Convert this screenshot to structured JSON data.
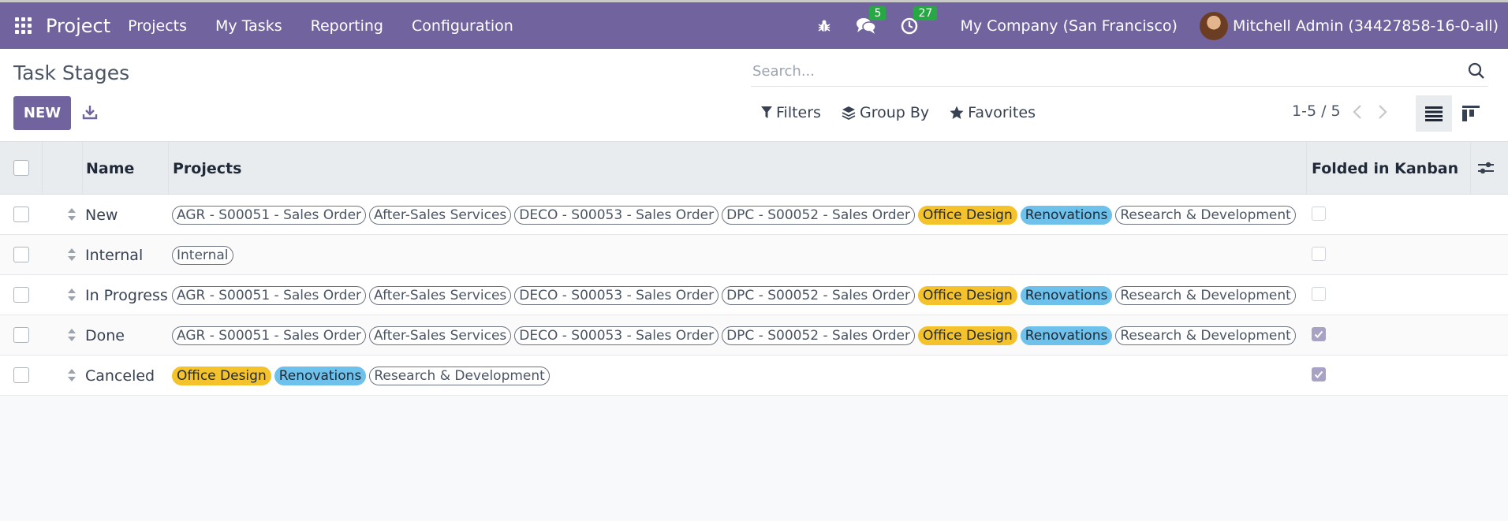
{
  "app": {
    "title": "Project",
    "menu": [
      "Projects",
      "My Tasks",
      "Reporting",
      "Configuration"
    ]
  },
  "systray": {
    "messages_count": "5",
    "activities_count": "27",
    "company": "My Company (San Francisco)",
    "user": "Mitchell Admin (34427858-16-0-all)"
  },
  "page": {
    "title": "Task Stages",
    "new_label": "NEW",
    "search_placeholder": "Search...",
    "filters_label": "Filters",
    "groupby_label": "Group By",
    "favorites_label": "Favorites",
    "pager": "1-5 / 5"
  },
  "colors": {
    "brand": "#71639e",
    "yellow_tag": "#f4c32c",
    "blue_tag": "#6ec1ea",
    "badge": "#28a745"
  },
  "table": {
    "headers": {
      "name": "Name",
      "projects": "Projects",
      "folded": "Folded in Kanban"
    },
    "rows": [
      {
        "name": "New",
        "projects": [
          {
            "label": "AGR - S00051 - Sales Order",
            "color": "none"
          },
          {
            "label": "After-Sales Services",
            "color": "none"
          },
          {
            "label": "DECO - S00053 - Sales Order",
            "color": "none"
          },
          {
            "label": "DPC - S00052 - Sales Order",
            "color": "none"
          },
          {
            "label": "Office Design",
            "color": "yellow"
          },
          {
            "label": "Renovations",
            "color": "blue"
          },
          {
            "label": "Research & Development",
            "color": "none"
          }
        ],
        "folded": false
      },
      {
        "name": "Internal",
        "projects": [
          {
            "label": "Internal",
            "color": "none"
          }
        ],
        "folded": false
      },
      {
        "name": "In Progress",
        "projects": [
          {
            "label": "AGR - S00051 - Sales Order",
            "color": "none"
          },
          {
            "label": "After-Sales Services",
            "color": "none"
          },
          {
            "label": "DECO - S00053 - Sales Order",
            "color": "none"
          },
          {
            "label": "DPC - S00052 - Sales Order",
            "color": "none"
          },
          {
            "label": "Office Design",
            "color": "yellow"
          },
          {
            "label": "Renovations",
            "color": "blue"
          },
          {
            "label": "Research & Development",
            "color": "none"
          }
        ],
        "folded": false
      },
      {
        "name": "Done",
        "projects": [
          {
            "label": "AGR - S00051 - Sales Order",
            "color": "none"
          },
          {
            "label": "After-Sales Services",
            "color": "none"
          },
          {
            "label": "DECO - S00053 - Sales Order",
            "color": "none"
          },
          {
            "label": "DPC - S00052 - Sales Order",
            "color": "none"
          },
          {
            "label": "Office Design",
            "color": "yellow"
          },
          {
            "label": "Renovations",
            "color": "blue"
          },
          {
            "label": "Research & Development",
            "color": "none"
          }
        ],
        "folded": true
      },
      {
        "name": "Canceled",
        "projects": [
          {
            "label": "Office Design",
            "color": "yellow"
          },
          {
            "label": "Renovations",
            "color": "blue"
          },
          {
            "label": "Research & Development",
            "color": "none"
          }
        ],
        "folded": true
      }
    ]
  }
}
